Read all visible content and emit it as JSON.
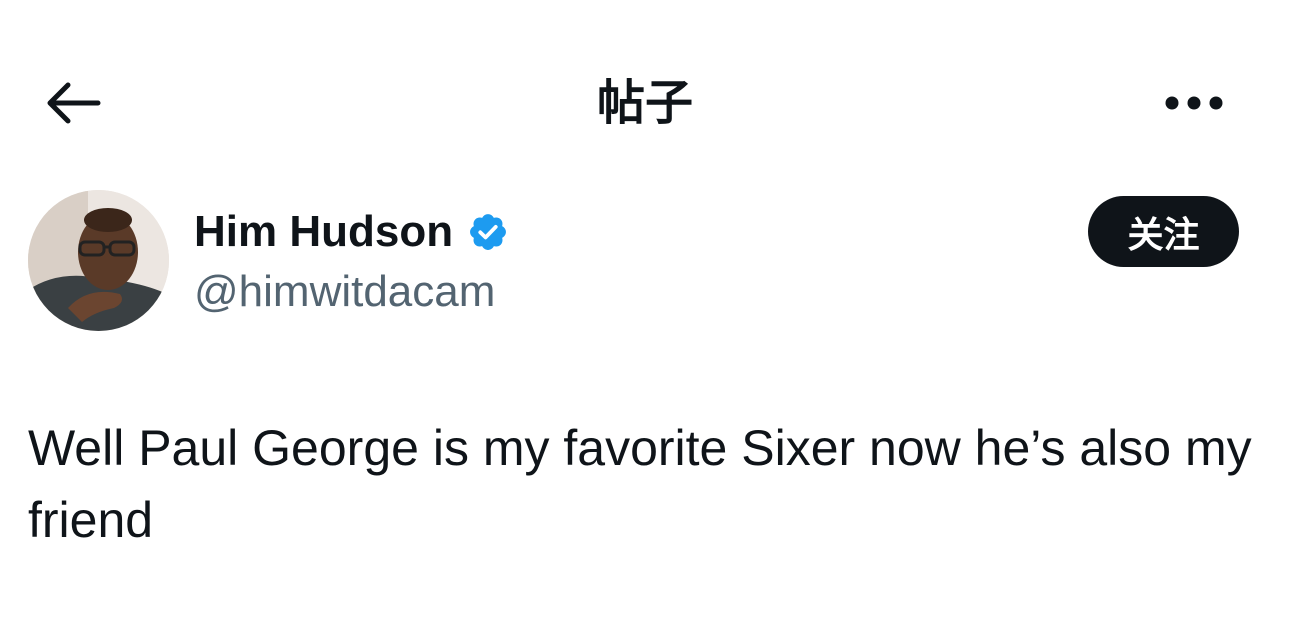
{
  "header": {
    "title": "帖子",
    "back_icon": "arrow-left-icon",
    "more_icon": "more-horizontal-icon"
  },
  "author": {
    "display_name": "Him Hudson",
    "handle": "@himwitdacam",
    "verified": true,
    "verified_color": "#1d9bf0"
  },
  "actions": {
    "follow_label": "关注"
  },
  "tweet": {
    "text": "Well Paul George is my favorite Sixer now he’s also my friend"
  },
  "colors": {
    "text_primary": "#0f1419",
    "text_secondary": "#536471",
    "follow_bg": "#0f1419",
    "accent": "#1d9bf0"
  }
}
